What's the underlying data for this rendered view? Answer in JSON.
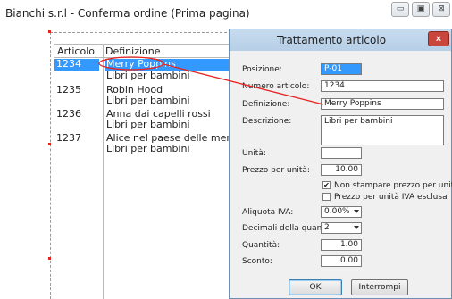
{
  "window": {
    "title": "Bianchi s.r.l - Conferma ordine (Prima pagina)",
    "buttons": {
      "minimize": "▭",
      "maximize": "▣",
      "close": "⊠"
    }
  },
  "document": {
    "headers": {
      "articolo": "Articolo",
      "definizione": "Definizione"
    },
    "rows": [
      {
        "code": "1234",
        "title": "Merry Poppins",
        "category": "Libri per bambini",
        "selected": true
      },
      {
        "code": "1235",
        "title": "Robin Hood",
        "category": "Libri per bambini",
        "selected": false
      },
      {
        "code": "1236",
        "title": "Anna dai capelli rossi",
        "category": "Libri per bambini",
        "selected": false
      },
      {
        "code": "1237",
        "title": "Alice nel paese delle meraviglie",
        "category": "Libri per bambini",
        "selected": false
      }
    ]
  },
  "dialog": {
    "title": "Trattamento articolo",
    "close_label": "×",
    "posizione": {
      "label": "Posizione:",
      "value": "P-01"
    },
    "numero_articolo": {
      "label": "Numero articolo:",
      "value": "1234"
    },
    "definizione": {
      "label": "Definizione:",
      "value": "Merry Poppins"
    },
    "descrizione": {
      "label": "Descrizione:",
      "value": "Libri per bambini"
    },
    "unita": {
      "label": "Unità:",
      "value": ""
    },
    "prezzo_unita": {
      "label": "Prezzo per unità:",
      "value": "10.00"
    },
    "non_stampare": {
      "label": "Non stampare prezzo per unità",
      "checked": true,
      "mark": "✔"
    },
    "iva_esclusa": {
      "label": "Prezzo per unità IVA esclusa",
      "checked": false,
      "mark": ""
    },
    "aliquota_iva": {
      "label": "Aliquota IVA:",
      "value": "0.00%"
    },
    "decimali": {
      "label": "Decimali della quantità:",
      "value": "2"
    },
    "quantita": {
      "label": "Quantità:",
      "value": "1.00"
    },
    "sconto": {
      "label": "Sconto:",
      "value": "0.00"
    },
    "ok_label": "OK",
    "cancel_label": "Interrompi"
  },
  "colors": {
    "selection": "#3399ff",
    "annotation": "#e8231f",
    "dialog_title": "#b6cfe7",
    "close": "#c9463d"
  }
}
